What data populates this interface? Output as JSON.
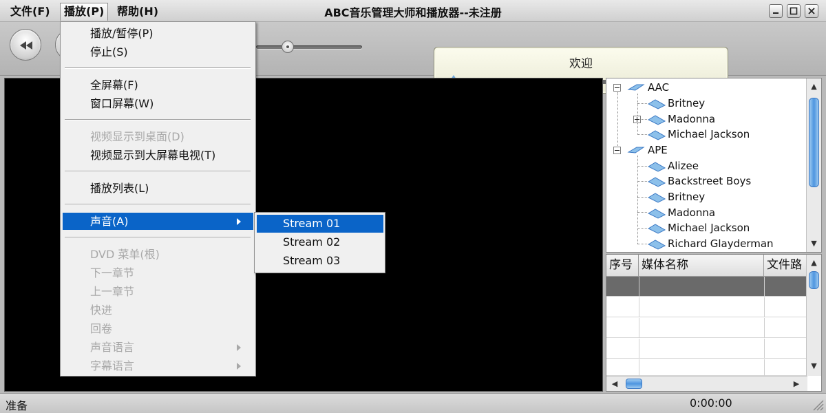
{
  "window": {
    "title": "ABC音乐管理大师和播放器--未注册"
  },
  "menubar": {
    "items": [
      {
        "label": "文件(F)"
      },
      {
        "label": "播放(P)"
      },
      {
        "label": "帮助(H)"
      }
    ]
  },
  "display": {
    "text": "欢迎"
  },
  "menu": {
    "items": [
      {
        "label": "播放/暂停(P)",
        "enabled": true
      },
      {
        "label": "停止(S)",
        "enabled": true
      },
      {
        "label": "全屏幕(F)",
        "enabled": true
      },
      {
        "label": "窗口屏幕(W)",
        "enabled": true
      },
      {
        "label": "视频显示到桌面(D)",
        "enabled": false
      },
      {
        "label": "视频显示到大屏幕电视(T)",
        "enabled": true
      },
      {
        "label": "播放列表(L)",
        "enabled": true
      },
      {
        "label": "声音(A)",
        "enabled": true,
        "highlighted": true
      },
      {
        "label": "DVD 菜单(根)",
        "enabled": false
      },
      {
        "label": "下一章节",
        "enabled": false
      },
      {
        "label": "上一章节",
        "enabled": false
      },
      {
        "label": "快进",
        "enabled": false
      },
      {
        "label": "回卷",
        "enabled": false
      },
      {
        "label": "声音语言",
        "enabled": false
      },
      {
        "label": "字幕语言",
        "enabled": false
      }
    ]
  },
  "submenu": {
    "items": [
      {
        "label": "Stream 01",
        "highlighted": true
      },
      {
        "label": "Stream 02"
      },
      {
        "label": "Stream 03"
      }
    ]
  },
  "tree": {
    "nodes": [
      {
        "label": "AAC",
        "expanded": true
      },
      {
        "label": "Britney"
      },
      {
        "label": "Madonna",
        "collapsed": true
      },
      {
        "label": "Michael Jackson"
      },
      {
        "label": "APE",
        "expanded": true
      },
      {
        "label": "Alizee"
      },
      {
        "label": "Backstreet Boys"
      },
      {
        "label": "Britney"
      },
      {
        "label": "Madonna"
      },
      {
        "label": "Michael Jackson"
      },
      {
        "label": "Richard Glayderman"
      }
    ]
  },
  "playlist": {
    "columns": [
      "序号",
      "媒体名称",
      "文件路"
    ]
  },
  "status": {
    "text": "准备",
    "time": "0:00:00"
  },
  "colors": {
    "menu_highlight": "#0a64c8",
    "video_background": "#000000",
    "display_background": "#fcfcee",
    "scroll_thumb": "#4d95e0"
  }
}
